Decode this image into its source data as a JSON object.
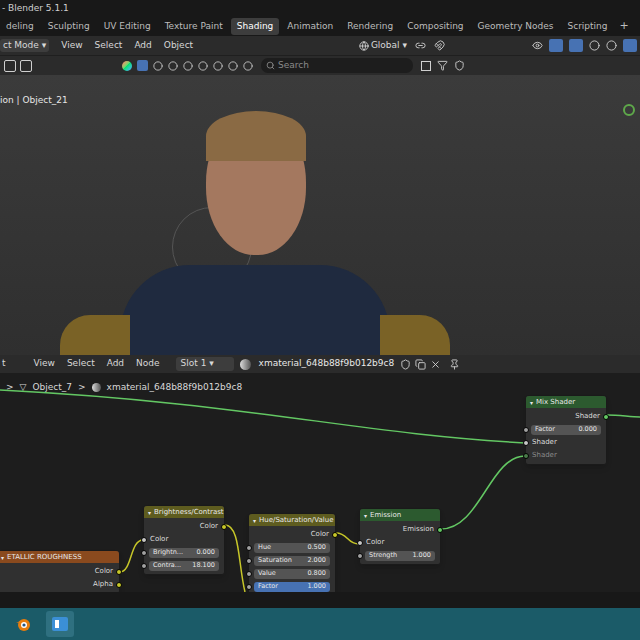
{
  "window": {
    "title": "- Blender 5.1.1"
  },
  "workspaces": [
    {
      "label": "deling",
      "selected": false
    },
    {
      "label": "Sculpting",
      "selected": false
    },
    {
      "label": "UV Editing",
      "selected": false
    },
    {
      "label": "Texture Paint",
      "selected": false
    },
    {
      "label": "Shading",
      "selected": true
    },
    {
      "label": "Animation",
      "selected": false
    },
    {
      "label": "Rendering",
      "selected": false
    },
    {
      "label": "Compositing",
      "selected": false
    },
    {
      "label": "Geometry Nodes",
      "selected": false
    },
    {
      "label": "Scripting",
      "selected": false
    }
  ],
  "add_workspace": "+",
  "viewport_header": {
    "mode": "ct Mode",
    "menus": [
      "View",
      "Select",
      "Add",
      "Object"
    ],
    "orientation": "Global"
  },
  "viewport_toolbar": {
    "search": {
      "placeholder": "Search"
    }
  },
  "viewport": {
    "overlay_text": "ion | Object_21"
  },
  "node_header": {
    "editor": "t",
    "menus": [
      "View",
      "Select",
      "Add",
      "Node"
    ],
    "slot": "Slot 1",
    "material": "xmaterial_648b88f9b012b9c8"
  },
  "breadcrumb": {
    "separator": ">",
    "items": [
      "Object_7",
      "xmaterial_648b88f9b012b9c8"
    ]
  },
  "nodes": [
    {
      "title": "Mix Shader",
      "color": "#2c5a2f",
      "rows": [
        {
          "kind": "output",
          "label": "Shader",
          "disabled": false
        },
        {
          "kind": "field",
          "label": "Factor",
          "value": "0.000",
          "selected": false
        },
        {
          "kind": "input",
          "label": "Shader",
          "disabled": false
        },
        {
          "kind": "input",
          "label": "Shader",
          "disabled": true
        }
      ]
    },
    {
      "title": "Brightness/Contrast",
      "color": "#5e5c1f",
      "rows": [
        {
          "kind": "output",
          "label": "Color",
          "disabled": false
        },
        {
          "kind": "input",
          "label": "Color",
          "disabled": false
        },
        {
          "kind": "field",
          "label": "Brightn...",
          "value": "0.000",
          "selected": false
        },
        {
          "kind": "field",
          "label": "Contra...",
          "value": "18.100",
          "selected": false
        }
      ]
    },
    {
      "title": "Hue/Saturation/Value",
      "color": "#5e5c1f",
      "rows": [
        {
          "kind": "output",
          "label": "Color",
          "disabled": false
        },
        {
          "kind": "field",
          "label": "Hue",
          "value": "0.500",
          "selected": false
        },
        {
          "kind": "field",
          "label": "Saturation",
          "value": "2.000",
          "selected": false
        },
        {
          "kind": "field",
          "label": "Value",
          "value": "0.800",
          "selected": false
        },
        {
          "kind": "field",
          "label": "Factor",
          "value": "1.000",
          "selected": true
        }
      ]
    },
    {
      "title": "Emission",
      "color": "#2c5a2f",
      "rows": [
        {
          "kind": "output",
          "label": "Emission",
          "disabled": false
        },
        {
          "kind": "input",
          "label": "Color",
          "disabled": false
        },
        {
          "kind": "field",
          "label": "Strength",
          "value": "1.000",
          "selected": false
        }
      ]
    },
    {
      "title": "ETALLIC ROUGHNESS",
      "color": "#8a4a1e",
      "rows": [
        {
          "kind": "output",
          "label": "Color",
          "disabled": false
        },
        {
          "kind": "output",
          "label": "Alpha",
          "disabled": false
        }
      ]
    }
  ]
}
